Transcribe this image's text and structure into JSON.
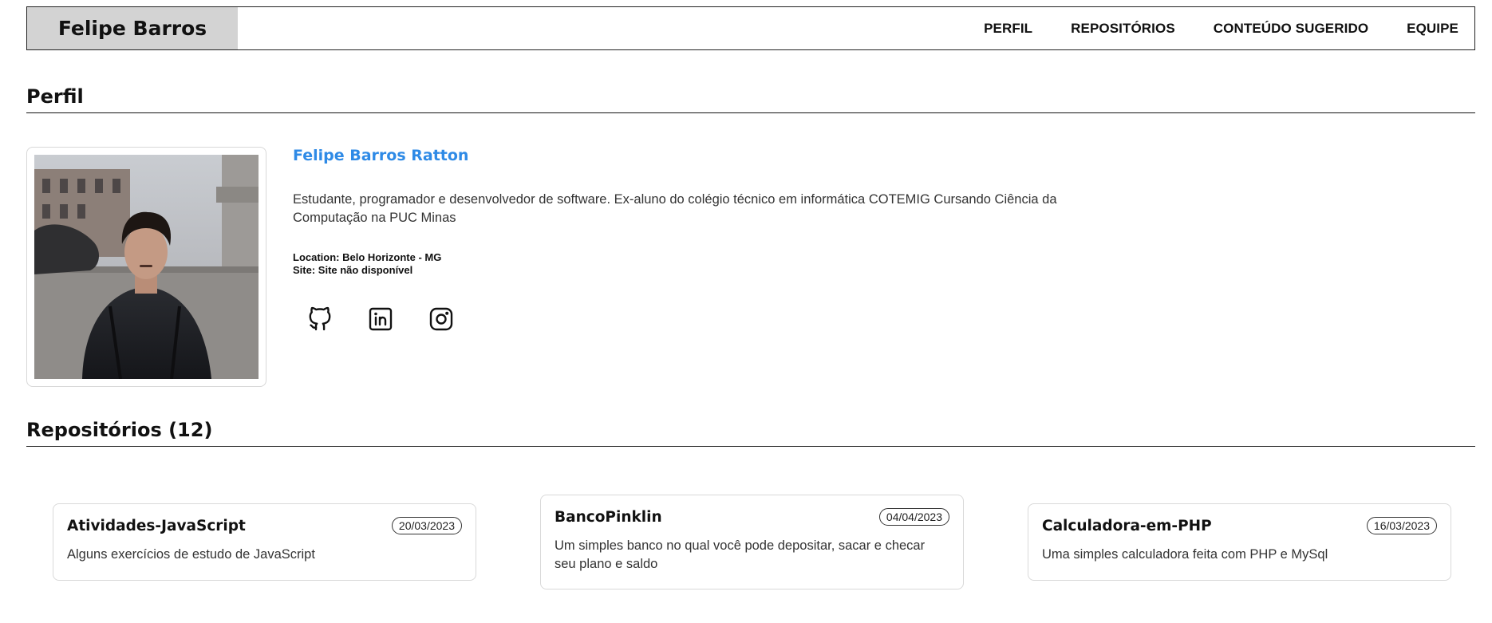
{
  "header": {
    "brand": "Felipe Barros",
    "nav": [
      "PERFIL",
      "REPOSITÓRIOS",
      "CONTEÚDO SUGERIDO",
      "EQUIPE"
    ]
  },
  "profile": {
    "section_title": "Perfil",
    "name": "Felipe Barros Ratton",
    "bio": "Estudante, programador e desenvolvedor de software. Ex-aluno do colégio técnico em informática COTEMIG Cursando Ciência da Computação na PUC Minas",
    "location": "Location: Belo Horizonte - MG",
    "site": "Site: Site não disponível",
    "socials": [
      "github-icon",
      "linkedin-icon",
      "instagram-icon"
    ],
    "name_color": "#2e8ae6"
  },
  "repositories": {
    "section_title": "Repositórios (12)",
    "items": [
      {
        "name": "Atividades-JavaScript",
        "date": "20/03/2023",
        "description": "Alguns exercícios de estudo de JavaScript"
      },
      {
        "name": "BancoPinklin",
        "date": "04/04/2023",
        "description": "Um simples banco no qual você pode depositar, sacar e checar seu plano e saldo"
      },
      {
        "name": "Calculadora-em-PHP",
        "date": "16/03/2023",
        "description": "Uma simples calculadora feita com PHP e MySql"
      }
    ]
  }
}
